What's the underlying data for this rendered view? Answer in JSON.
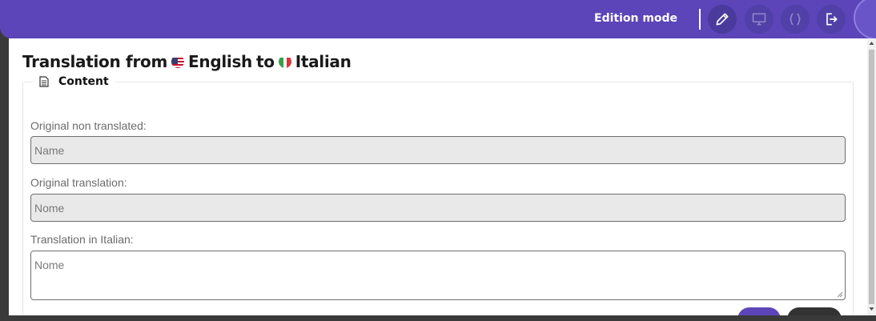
{
  "topbar": {
    "mode_label": "Edition mode",
    "buttons": [
      {
        "icon": "pencil-icon",
        "active": true
      },
      {
        "icon": "monitor-icon"
      },
      {
        "icon": "code-braces-icon"
      },
      {
        "icon": "logout-icon"
      }
    ]
  },
  "dialog": {
    "title_prefix": "Translation from",
    "source_language": "English",
    "title_middle": "to",
    "target_language": "Italian",
    "section_label": "Content",
    "fields": [
      {
        "label": "Original non translated:",
        "value": "Name",
        "readonly": true
      },
      {
        "label": "Original translation:",
        "value": "Nome",
        "readonly": true
      },
      {
        "label": "Translation in Italian:",
        "value": "Nome",
        "readonly": false
      }
    ]
  },
  "colors": {
    "accent": "#5b45b8",
    "readonly_bg": "#e9e9e9"
  }
}
